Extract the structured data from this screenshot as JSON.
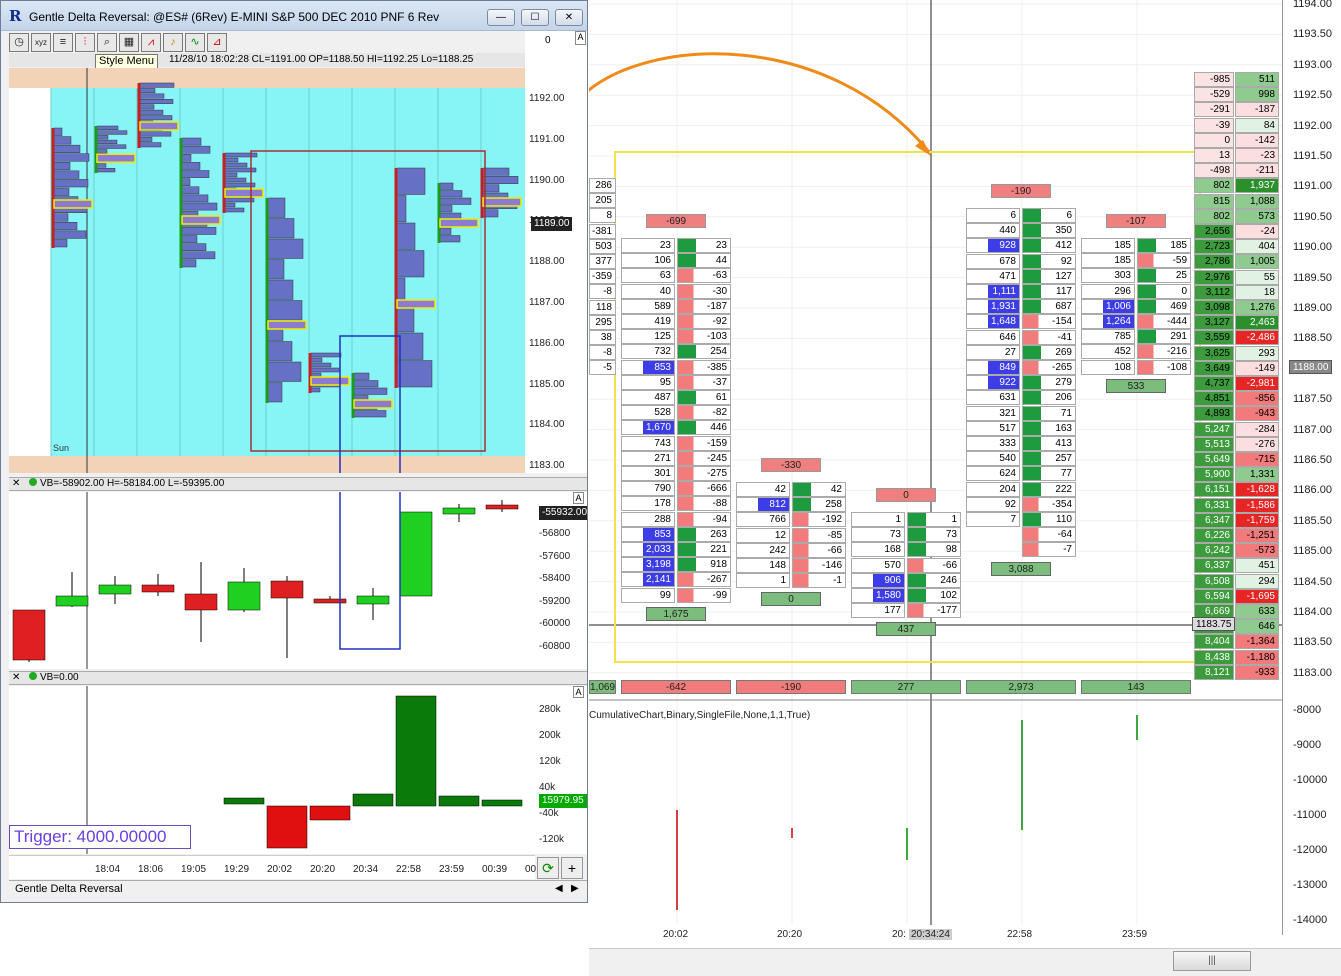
{
  "window": {
    "title": "Gentle Delta Reversal: @ES# (6Rev) E-MINI S&P 500 DEC 2010 PNF 6 Rev",
    "logo": "R",
    "minimize": "—",
    "maximize": "☐",
    "close": "✕"
  },
  "toolbar": {
    "icons": [
      "clock-icon",
      "xyz-icon",
      "stack-icon",
      "bars-icon",
      "zoom-icon",
      "grid-icon",
      "chart-icon",
      "bell-icon",
      "wave-icon",
      "marker-icon"
    ],
    "tooltip": "Style Menu",
    "status_text": "11/28/10 18:02:28 CL=1191.00 OP=1188.50 HI=1192.25 Lo=1188.25"
  },
  "chart1": {
    "y_labels": [
      "1192.00",
      "1191.00",
      "1190.00",
      "1189.00",
      "1188.00",
      "1187.00",
      "1186.00",
      "1185.00",
      "1184.00",
      "1183.00"
    ],
    "current_price": "1189.00",
    "top_label": "0",
    "session_label": "Sun"
  },
  "pane2": {
    "header": "VB=-58902.00 H=-58184.00 L=-59395.00",
    "y_labels": [
      "-56800",
      "-57600",
      "-58400",
      "-59200",
      "-60000",
      "-60800"
    ],
    "current": "-55932.00"
  },
  "pane3": {
    "header": "VB=0.00",
    "y_labels": [
      "280k",
      "200k",
      "120k",
      "40k",
      "-40k",
      "-120k"
    ],
    "current": "15979.95"
  },
  "trigger": "Trigger: 4000.00000",
  "left_x_labels": [
    "18:04",
    "18:06",
    "19:05",
    "19:29",
    "20:02",
    "20:20",
    "20:34",
    "22:58",
    "23:59",
    "00:39",
    "00"
  ],
  "tab": "Gentle Delta Reversal",
  "right": {
    "y_labels": [
      "1194.00",
      "1193.50",
      "1193.00",
      "1192.50",
      "1192.00",
      "1191.50",
      "1191.00",
      "1190.50",
      "1190.00",
      "1189.50",
      "1189.00",
      "1188.50",
      "1188.00",
      "1187.50",
      "1187.00",
      "1186.50",
      "1186.00",
      "1185.50",
      "1185.00",
      "1184.50",
      "1184.00",
      "1183.50",
      "1183.00"
    ],
    "price_tag": "1188.00",
    "price_tag2": "1183.75",
    "lower_y_labels": [
      "-8000",
      "-9000",
      "-10000",
      "-11000",
      "-12000",
      "-13000",
      "-14000"
    ],
    "x_labels": [
      "20:02",
      "20:20",
      "20:34:24",
      "22:58",
      "23:59"
    ],
    "x_label_prefix": "20:",
    "formula": "CumulativeChart,Binary,SingleFile,None,1,1,True)",
    "bottom_totals": [
      "1,069",
      "-642",
      "-190",
      "277",
      "2,973",
      "143"
    ],
    "scroll_grip": "|||"
  },
  "ladder": {
    "left": [
      "-985",
      "-529",
      "-291",
      "-39",
      "0",
      "13",
      "-498",
      "802",
      "815",
      "802",
      "2,656",
      "2,723",
      "2,786",
      "2,976",
      "3,112",
      "3,098",
      "3,127",
      "3,559",
      "3,625",
      "3,649",
      "4,737",
      "4,851",
      "4,893",
      "5,247",
      "5,513",
      "5,649",
      "5,900",
      "6,151",
      "6,331",
      "6,347",
      "6,226",
      "6,242",
      "6,337",
      "6,508",
      "6,594",
      "6,669",
      "7,399",
      "8,404",
      "8,438",
      "8,121"
    ],
    "right": [
      "511",
      "998",
      "-187",
      "84",
      "-142",
      "-23",
      "-211",
      "1,937",
      "1,088",
      "573",
      "-24",
      "404",
      "1,005",
      "55",
      "18",
      "1,276",
      "2,463",
      "-2,486",
      "293",
      "-149",
      "-2,981",
      "-856",
      "-943",
      "-284",
      "-276",
      "-715",
      "1,331",
      "-1,628",
      "-1,586",
      "-1,759",
      "-1,251",
      "-573",
      "451",
      "294",
      "-1,695",
      "633",
      "646",
      "-1,364",
      "-1,180",
      "-933"
    ]
  },
  "bars": [
    {
      "head": "-699",
      "headcolor": "#f08080",
      "foot": "1,675",
      "bid": [
        "23",
        "106",
        "63",
        "40",
        "589",
        "419",
        "125",
        "732",
        "853",
        "95",
        "487",
        "528",
        "1,670",
        "743",
        "271",
        "301",
        "790",
        "178",
        "288",
        "853",
        "2,033",
        "3,198",
        "2,141",
        "99"
      ],
      "ask": [
        "23",
        "44",
        "-63",
        "-30",
        "-187",
        "-92",
        "-103",
        "254",
        "-385",
        "-37",
        "61",
        "-82",
        "446",
        "-159",
        "-245",
        "-275",
        "-666",
        "-88",
        "-94",
        "263",
        "221",
        "918",
        "-267",
        "-99"
      ]
    },
    {
      "head": "-330",
      "headcolor": "#f08080",
      "foot": "0",
      "bid": [
        "42",
        "812",
        "766",
        "12",
        "242",
        "148",
        "1"
      ],
      "ask": [
        "42",
        "258",
        "-192",
        "-85",
        "-66",
        "-146",
        "-1"
      ]
    },
    {
      "head": "0",
      "headcolor": "#f08080",
      "foot": "437",
      "bid": [
        "1",
        "73",
        "168",
        "570",
        "906",
        "1,580",
        "177"
      ],
      "ask": [
        "1",
        "73",
        "98",
        "-66",
        "246",
        "102",
        "-177"
      ]
    },
    {
      "head": "-190",
      "headcolor": "#f08080",
      "foot": "3,088",
      "bid": [
        "6",
        "440",
        "928",
        "678",
        "471",
        "1,111",
        "1,931",
        "1,648",
        "646",
        "27",
        "849",
        "922",
        "631",
        "321",
        "517",
        "333",
        "540",
        "624",
        "204",
        "92",
        "7"
      ],
      "ask": [
        "6",
        "350",
        "412",
        "92",
        "127",
        "117",
        "687",
        "-154",
        "-41",
        "269",
        "-265",
        "279",
        "206",
        "71",
        "163",
        "413",
        "257",
        "77",
        "222",
        "-354",
        "110",
        "-64",
        "-7"
      ]
    },
    {
      "head": "-107",
      "headcolor": "#f08080",
      "foot": "533",
      "bid": [
        "185",
        "185",
        "303",
        "296",
        "1,006",
        "1,264",
        "785",
        "452",
        "108"
      ],
      "ask": [
        "185",
        "-59",
        "25",
        "0",
        "469",
        "-444",
        "291",
        "-216",
        "-108"
      ]
    }
  ],
  "side_values": [
    "286",
    "205",
    "8",
    "-381",
    "503",
    "377",
    "-359",
    "-8",
    "118",
    "295",
    "38",
    "-8",
    "-5"
  ]
}
